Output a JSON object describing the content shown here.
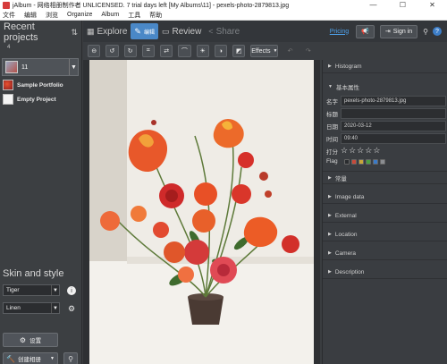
{
  "window": {
    "title": "jAlbum - 网络相册制作者 UNLICENSED. 7 trial days left [My Albums\\11] - pexels-photo-2879813.jpg",
    "minimize": "—",
    "maximize": "☐",
    "close": "✕"
  },
  "menu": [
    "文件",
    "编辑",
    "浏览",
    "Organize",
    "Album",
    "工具",
    "帮助"
  ],
  "left": {
    "heading": "Recent projects",
    "sort_icon": "⇅",
    "count": "4",
    "album": {
      "name": "11",
      "dropdown": "▼"
    },
    "projects": [
      {
        "label": "Sample Portfolio"
      },
      {
        "label": "Empty Project"
      }
    ],
    "skin_heading": "Skin and style",
    "skin": "Tiger",
    "style": "Linen",
    "settings_label": "设置",
    "make_label": "创建相册",
    "make_dropdown": "▼"
  },
  "modes": {
    "explore": "Explore",
    "edit": "编辑",
    "review": "Review",
    "share": "Share",
    "pricing": "Pricing",
    "signin": "Sign in",
    "help": "?"
  },
  "editbar": {
    "effects": "Effects",
    "effects_dropdown": "▼"
  },
  "right": {
    "histogram": "Histogram",
    "basic": "基本属性",
    "fields": [
      {
        "key": "名字",
        "value": "pexels-photo-2879813.jpg"
      },
      {
        "key": "标题",
        "value": ""
      },
      {
        "key": "日期",
        "value": "2020-03-12"
      },
      {
        "key": "时间",
        "value": "09:40"
      }
    ],
    "rating_label": "打分",
    "flag_label": "Flag",
    "flag_colors": [
      "#2a2c2f",
      "#c84a3a",
      "#c8a63a",
      "#4aa040",
      "#3a7ac8",
      "#8a8d91"
    ],
    "sections": [
      "常量",
      "Image data",
      "External",
      "Location",
      "Camera",
      "Description"
    ]
  }
}
